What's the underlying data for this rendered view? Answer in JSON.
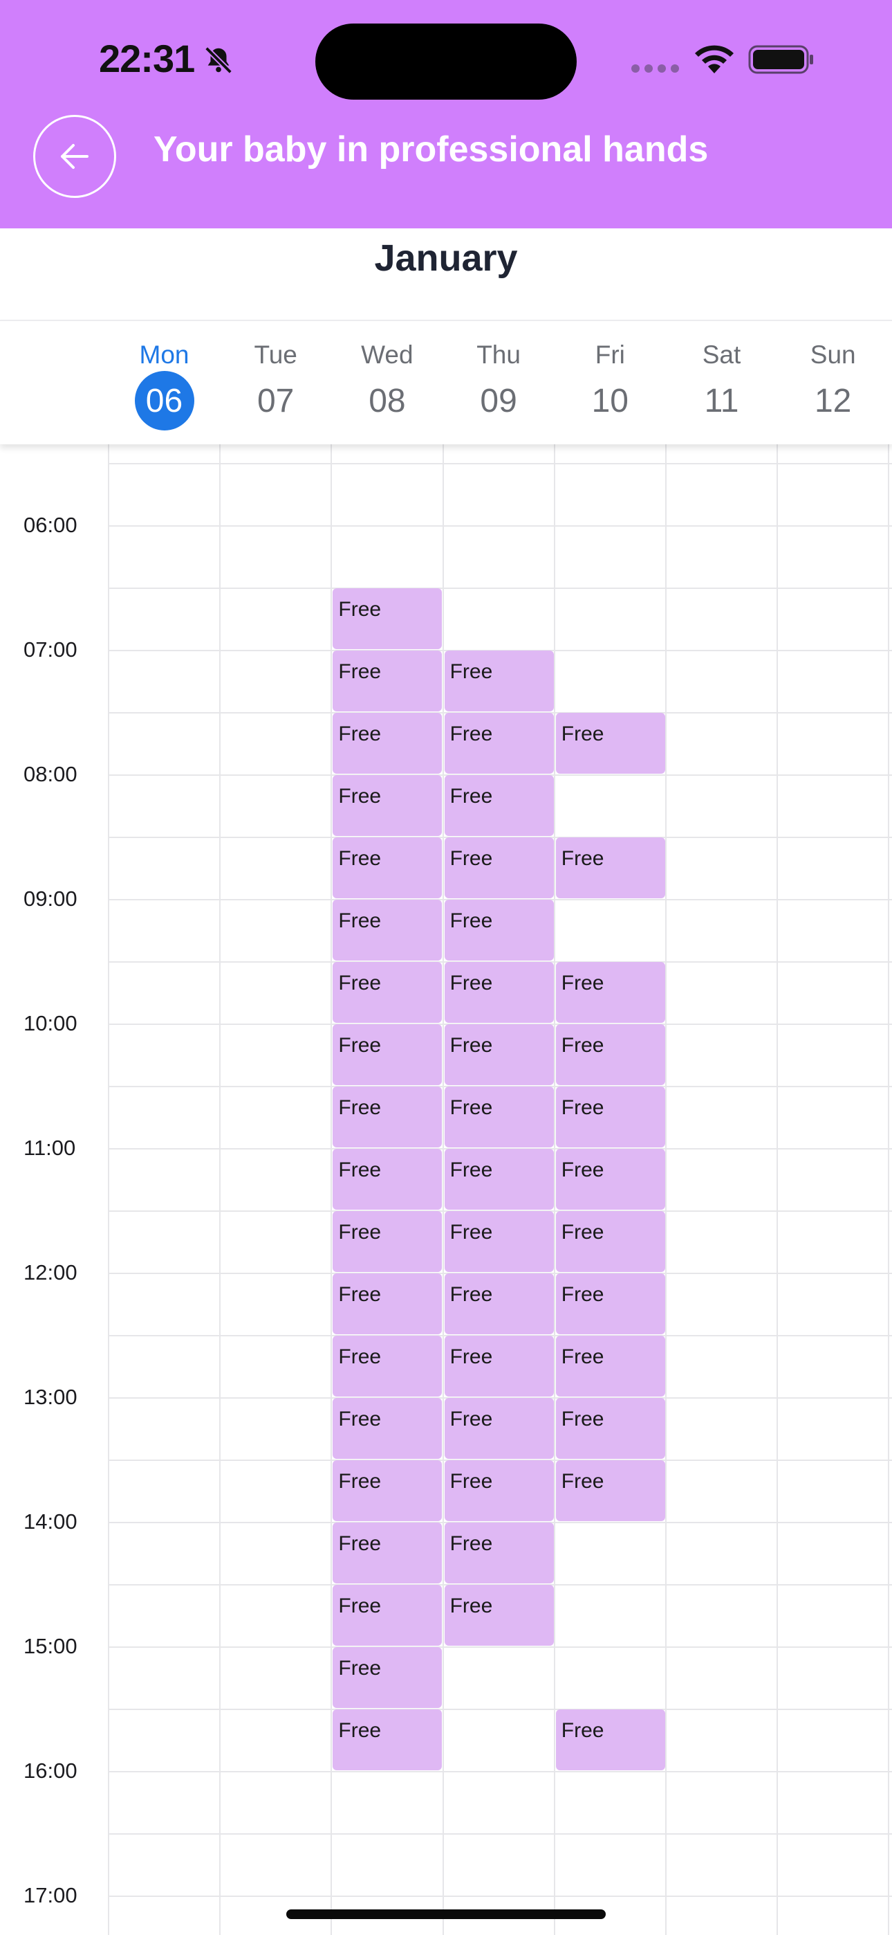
{
  "status_bar": {
    "time": "22:31",
    "icons": [
      "bell-slash-icon",
      "signal-icon",
      "wifi-icon",
      "battery-icon"
    ]
  },
  "header": {
    "title": "Your baby in professional hands",
    "back_icon": "arrow-left-icon",
    "background_color": "#d07ffc"
  },
  "calendar": {
    "month": "January",
    "selected_day_index": 0,
    "accent_color": "#1e78e6",
    "slot_color": "#dfb8f4",
    "days": [
      {
        "name": "Mon",
        "num": "06"
      },
      {
        "name": "Tue",
        "num": "07"
      },
      {
        "name": "Wed",
        "num": "08"
      },
      {
        "name": "Thu",
        "num": "09"
      },
      {
        "name": "Fri",
        "num": "10"
      },
      {
        "name": "Sat",
        "num": "11"
      },
      {
        "name": "Sun",
        "num": "12"
      }
    ],
    "times": [
      "06:00",
      "07:00",
      "08:00",
      "09:00",
      "10:00",
      "11:00",
      "12:00",
      "13:00",
      "14:00",
      "15:00",
      "16:00",
      "17:00"
    ],
    "slot_label": "Free",
    "free_slots": {
      "Wed": [
        "06:30",
        "07:00",
        "07:30",
        "08:00",
        "08:30",
        "09:00",
        "09:30",
        "10:00",
        "10:30",
        "11:00",
        "11:30",
        "12:00",
        "12:30",
        "13:00",
        "13:30",
        "14:00",
        "14:30",
        "15:00",
        "15:30"
      ],
      "Thu": [
        "07:00",
        "07:30",
        "08:00",
        "08:30",
        "09:00",
        "09:30",
        "10:00",
        "10:30",
        "11:00",
        "11:30",
        "12:00",
        "12:30",
        "13:00",
        "13:30",
        "14:00",
        "14:30"
      ],
      "Fri": [
        "07:30",
        "08:30",
        "09:30",
        "10:00",
        "10:30",
        "11:00",
        "11:30",
        "12:00",
        "12:30",
        "13:00",
        "13:30",
        "15:30"
      ]
    }
  }
}
